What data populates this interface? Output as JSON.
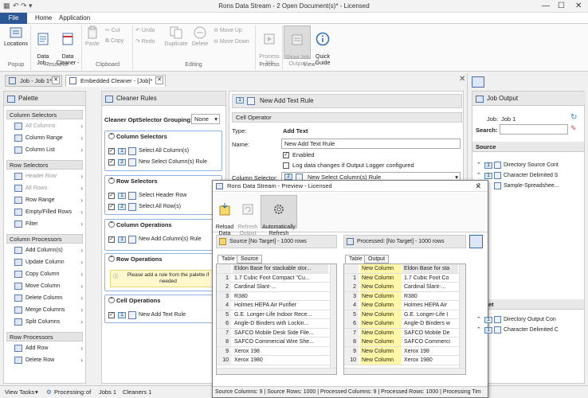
{
  "window": {
    "title": "Rons Data Stream - 2 Open Document(s)* - Licensed",
    "minimize": "—",
    "maximize": "☐",
    "close": "✕"
  },
  "menu": {
    "file": "File",
    "home": "Home",
    "application": "Application"
  },
  "ribbon": {
    "locations": "Locations",
    "data_job": "Data\nJob -",
    "data_cleaner": "Data\nCleaner -",
    "paste": "Paste",
    "cut": "Cut",
    "copy": "Copy",
    "undo": "Undo",
    "redo": "Redo",
    "duplicate": "Duplicate",
    "delete": "Delete",
    "move_up": "Move Up",
    "move_down": "Move Down",
    "process_job": "Process\nJob",
    "show_job_output": "Show Job\nOutput",
    "quick_guide": "Quick\nGuide",
    "groups": {
      "popup": "Popup",
      "resource": "Resource",
      "clipboard": "Clipboard",
      "editing": "Editing",
      "process": "Process",
      "view": "View"
    }
  },
  "doc_tabs": [
    {
      "label": "Job - Job 1*"
    },
    {
      "label": "Embedded Cleaner - [Job]*"
    }
  ],
  "palette": {
    "title": "Palette",
    "sections": [
      {
        "label": "Column Selectors",
        "items": [
          {
            "label": "All Columns",
            "disabled": true
          },
          {
            "label": "Column Range",
            "disabled": false
          },
          {
            "label": "Column List",
            "disabled": false
          }
        ]
      },
      {
        "label": "Row Selectors",
        "items": [
          {
            "label": "Header Row",
            "disabled": true
          },
          {
            "label": "All Rows",
            "disabled": true
          },
          {
            "label": "Row Range",
            "disabled": false
          },
          {
            "label": "Empty/Filled Rows",
            "disabled": false
          },
          {
            "label": "Filter",
            "disabled": false
          }
        ]
      },
      {
        "label": "Column Processors",
        "items": [
          {
            "label": "Add Column(s)",
            "disabled": false
          },
          {
            "label": "Update Column",
            "disabled": false
          },
          {
            "label": "Copy Column",
            "disabled": false
          },
          {
            "label": "Move Column",
            "disabled": false
          },
          {
            "label": "Delete Column",
            "disabled": false
          },
          {
            "label": "Merge Columns",
            "disabled": false
          },
          {
            "label": "Split Columns",
            "disabled": false
          }
        ]
      },
      {
        "label": "Row Processors",
        "items": [
          {
            "label": "Add Row",
            "disabled": false
          },
          {
            "label": "Delete Row",
            "disabled": false
          }
        ]
      }
    ]
  },
  "cleaner": {
    "title": "Cleaner Rules",
    "grouping_label": "Cleaner OptSelector Grouping:",
    "grouping_value": "None",
    "column_selectors": {
      "title": "Column Selectors",
      "items": [
        {
          "num": "1",
          "label": "Select All Column(s)"
        },
        {
          "num": "2",
          "label": "New Select Column(s) Rule"
        }
      ]
    },
    "row_selectors": {
      "title": "Row Selectors",
      "items": [
        {
          "num": "1",
          "label": "Select Header Row"
        },
        {
          "num": "2",
          "label": "Select All Row(s)"
        }
      ]
    },
    "column_operations": {
      "title": "Column Operations",
      "items": [
        {
          "num": "1",
          "label": "New Add Column(s) Rule"
        }
      ]
    },
    "row_operations": {
      "title": "Row Operations",
      "hint": "Please add a rule from the palette if needed"
    },
    "cell_operations": {
      "title": "Cell Operations",
      "items": [
        {
          "num": "1",
          "label": "New Add Text Rule"
        }
      ]
    }
  },
  "rule": {
    "header_num": "1",
    "header_label": "New Add Text Rule",
    "section": "Cell Operator",
    "type_label": "Type:",
    "type_value": "Add Text",
    "name_label": "Name:",
    "name_value": "New Add Text Rule",
    "enabled": "Enabled",
    "log": "Log data changes if Output Logger configured",
    "column_selector_label": "Column Selector:",
    "column_selector_num": "2",
    "column_selector_value": "New Select Column(s) Rule"
  },
  "job_output": {
    "title": "Job Output",
    "job_label": "Job:",
    "job_value": "Job 1",
    "search_label": "Search:",
    "source_title": "Source",
    "source_items": [
      {
        "num": "1",
        "label": "Directory Source Cont"
      },
      {
        "num": "1",
        "label": "Character Delimited S"
      },
      {
        "num": "",
        "label": "Sample-Spreadshee..."
      }
    ],
    "target_title": "et",
    "target_items": [
      {
        "num": "1",
        "label": "Directory Output Con"
      },
      {
        "num": "1",
        "label": "Character Delimited C"
      }
    ]
  },
  "preview": {
    "title": "Rons Data Stream - Preview - Licensed",
    "reload": "Reload\nData",
    "refresh": "Refresh\nOutput",
    "auto_refresh": "Automatically\nRefresh",
    "source_header": "Source [No Target] - 1000 rows",
    "processed_header": "Processed: [No Target] - 1000 rows",
    "source_tabs": [
      "Table",
      "Source"
    ],
    "processed_tabs": [
      "Table",
      "Output"
    ],
    "source_col_header": "Eldon Base for stackable stor...",
    "source_rows": [
      {
        "n": "1",
        "v": "1.7 Cubic Foot Compact \"Cu..."
      },
      {
        "n": "2",
        "v": "Cardinal Slant-..."
      },
      {
        "n": "3",
        "v": "R380"
      },
      {
        "n": "4",
        "v": "Holmes HEPA Air Purifier"
      },
      {
        "n": "5",
        "v": "G.E. Longer-Life Indoor Rece..."
      },
      {
        "n": "6",
        "v": "Angle-D Binders with Lockin..."
      },
      {
        "n": "7",
        "v": "SAFCO Mobile Desk Side File..."
      },
      {
        "n": "8",
        "v": "SAFCO Commercial Wire She..."
      },
      {
        "n": "9",
        "v": "Xerox 198"
      },
      {
        "n": "10",
        "v": "Xerox 1980"
      }
    ],
    "processed_col1": "New Column",
    "processed_col2": "Eldon Base for sta",
    "processed_rows": [
      {
        "n": "1",
        "a": "New Column",
        "b": "1.7 Cubic Foot Co"
      },
      {
        "n": "2",
        "a": "New Column",
        "b": "Cardinal Slant-..."
      },
      {
        "n": "3",
        "a": "New Column",
        "b": "R380"
      },
      {
        "n": "4",
        "a": "New Column",
        "b": "Holmes HEPA Air"
      },
      {
        "n": "5",
        "a": "New Column",
        "b": "G.E. Longer-Life I"
      },
      {
        "n": "6",
        "a": "New Column",
        "b": "Angle-D Binders w"
      },
      {
        "n": "7",
        "a": "New Column",
        "b": "SAFCO Mobile De"
      },
      {
        "n": "8",
        "a": "New Column",
        "b": "SAFCO Commerci"
      },
      {
        "n": "9",
        "a": "New Column",
        "b": "Xerox 198"
      },
      {
        "n": "10",
        "a": "New Column",
        "b": "Xerox 1980"
      }
    ],
    "status": "Source Columns: 9 | Source Rows: 1000 | Processed Columns: 9 | Processed Rows: 1000 | Processing Tim"
  },
  "statusbar": {
    "view_tasks": "View Tasks",
    "processing": "Processing:",
    "of": "of",
    "jobs": "Jobs 1",
    "cleaners": "Cleaners 1"
  }
}
